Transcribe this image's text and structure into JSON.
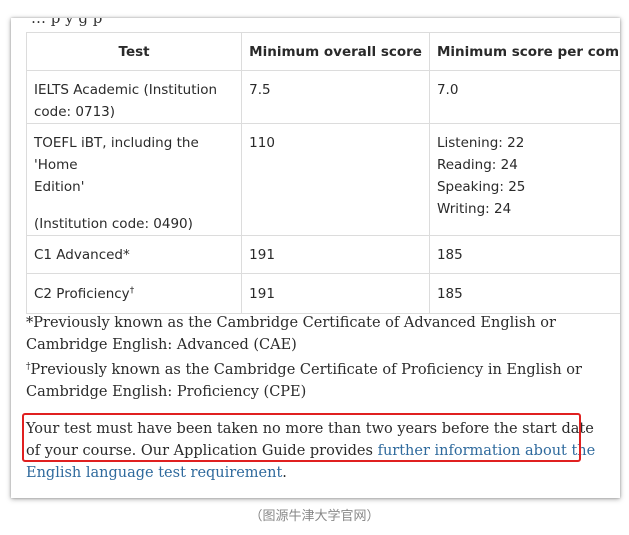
{
  "clipped_heading": "…             p                              y  g          p",
  "table": {
    "headers": [
      "Test",
      "Minimum overall score",
      "Minimum score per compo"
    ],
    "rows": [
      {
        "test": [
          "IELTS Academic (Institution code: 0713)"
        ],
        "overall": "7.5",
        "component": [
          "7.0"
        ]
      },
      {
        "test": [
          "TOEFL iBT, including the 'Home",
          "Edition'",
          "",
          "(Institution code: 0490)"
        ],
        "overall": "110",
        "component": [
          "Listening: 22",
          "Reading: 24",
          "Speaking: 25",
          "Writing: 24"
        ]
      },
      {
        "test": [
          "C1 Advanced*"
        ],
        "overall": "191",
        "component": [
          "185"
        ]
      },
      {
        "test_main": "C2 Proficiency",
        "test_mark": "†",
        "overall": "191",
        "component": [
          "185"
        ]
      }
    ]
  },
  "notes": {
    "note1": "*Previously known as the Cambridge Certificate of Advanced English or Cambridge English: Advanced (CAE)",
    "note2_mark": "†",
    "note2": "Previously known as the Cambridge Certificate of Proficiency in English or Cambridge English: Proficiency (CPE)"
  },
  "paragraph": {
    "text_before": "Your test must have been taken no more than two years before the start date of your course. Our Application Guide provides ",
    "link_text": "further information about the English language test requirement",
    "text_after": "."
  },
  "source_caption": "（图源牛津大学官网）",
  "colors": {
    "link": "#2f6a9d",
    "highlight": "#e02020",
    "border": "#dcdcdc"
  }
}
